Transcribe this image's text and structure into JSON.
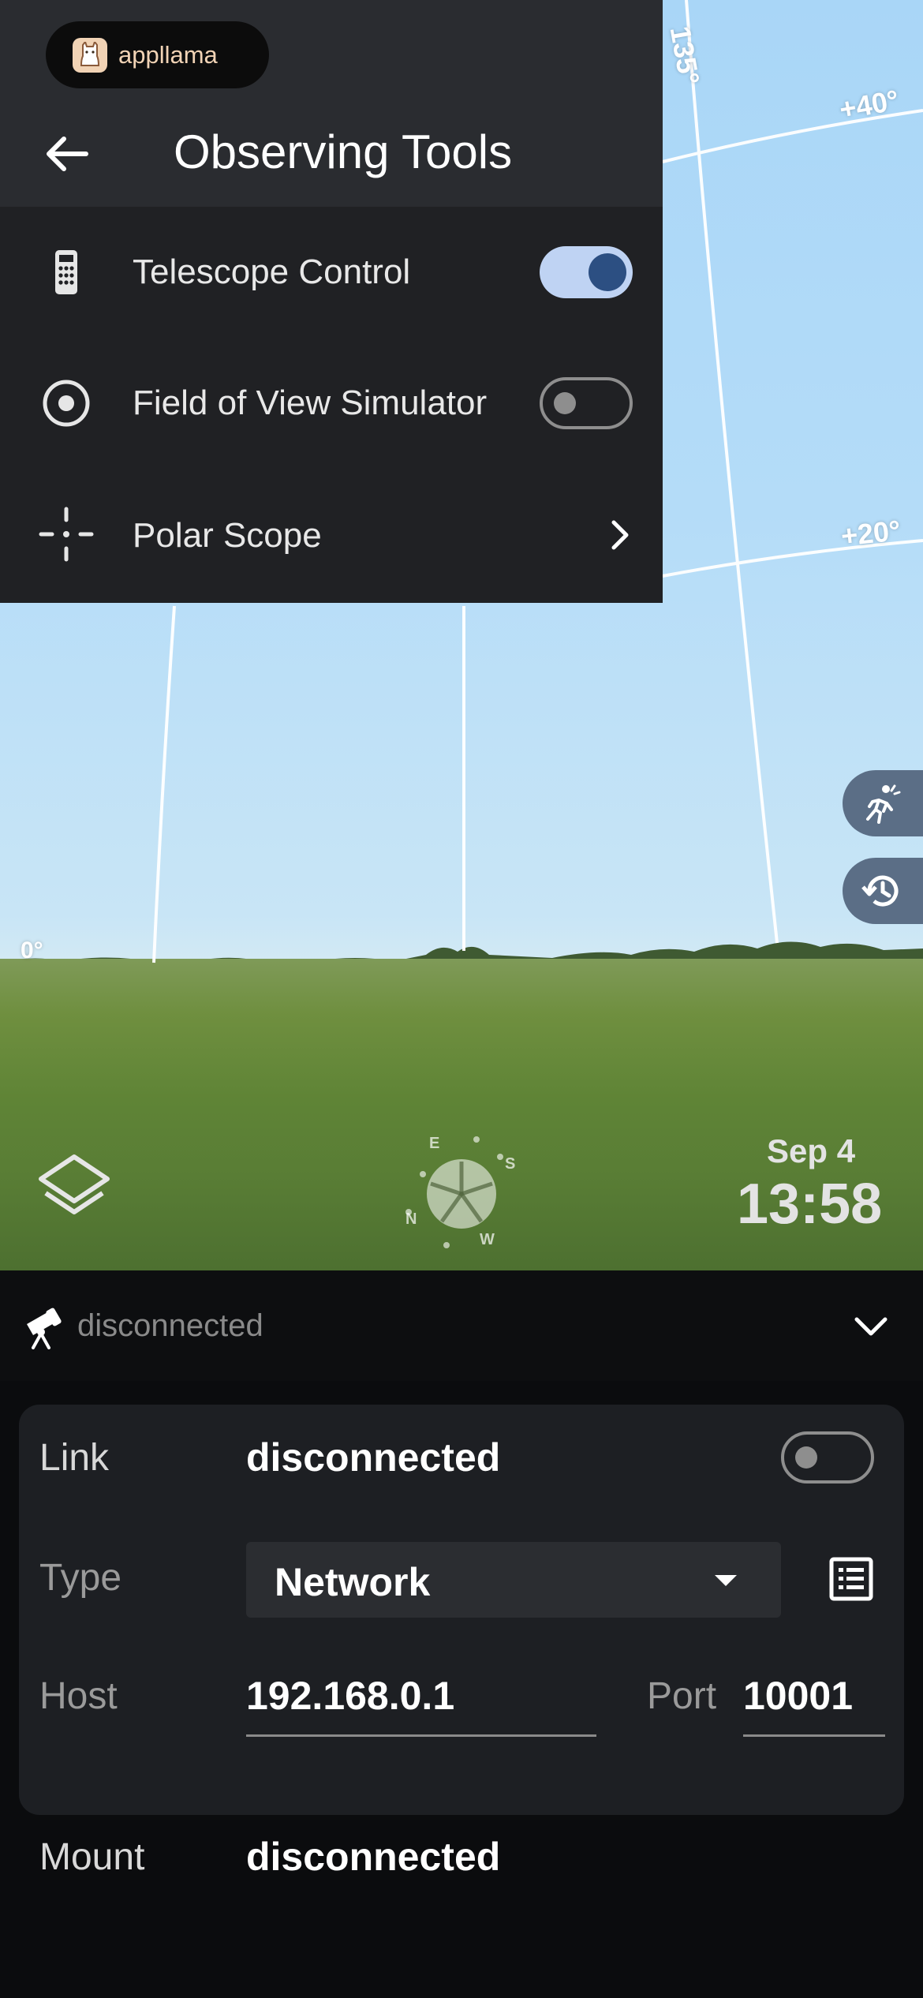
{
  "brand": {
    "name": "appllama"
  },
  "observing_tools": {
    "title": "Observing Tools",
    "items": [
      {
        "label": "Telescope Control",
        "icon": "remote-control-icon",
        "toggle": true
      },
      {
        "label": "Field of View Simulator",
        "icon": "target-icon",
        "toggle": false
      },
      {
        "label": "Polar Scope",
        "icon": "crosshair-icon",
        "arrow": true
      }
    ]
  },
  "sky": {
    "grid_labels": {
      "azimuth": "135°",
      "alt_high": "+40°",
      "alt_low": "+20°",
      "horizon": "0°"
    },
    "compass": {
      "n": "N",
      "e": "E",
      "s": "S",
      "w": "W"
    },
    "date": "Sep 4",
    "time": "13:58"
  },
  "connection": {
    "status": "disconnected",
    "link_label": "Link",
    "link_value": "disconnected",
    "type_label": "Type",
    "type_value": "Network",
    "host_label": "Host",
    "host_value": "192.168.0.1",
    "port_label": "Port",
    "port_value": "10001",
    "mount_label": "Mount",
    "mount_value": "disconnected"
  },
  "colors": {
    "accent": "#2c4f82",
    "toggle_track_on": "#bfd3f3",
    "panel": "#202124",
    "header": "#2a2c30"
  }
}
